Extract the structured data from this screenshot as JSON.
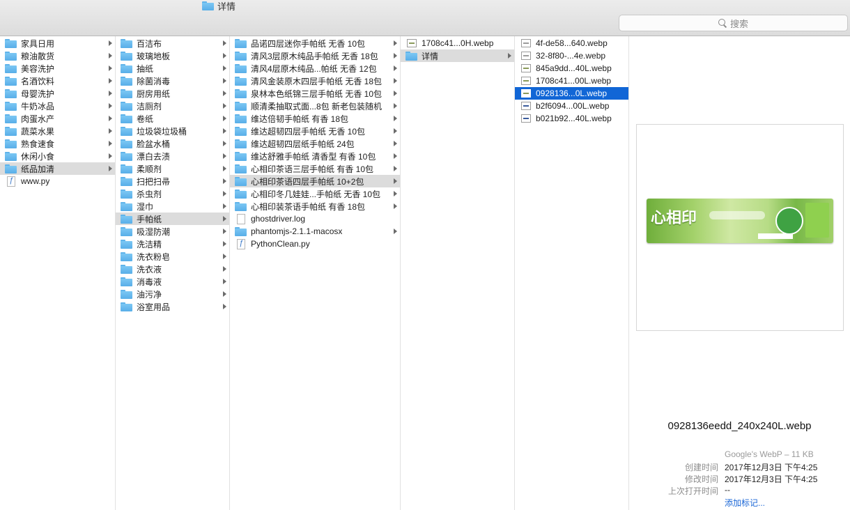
{
  "window": {
    "title": "详情"
  },
  "search": {
    "placeholder": "搜索"
  },
  "columns": {
    "c1": [
      {
        "label": "家具日用",
        "type": "folder",
        "arrow": true
      },
      {
        "label": "粮油散货",
        "type": "folder",
        "arrow": true
      },
      {
        "label": "美容洗护",
        "type": "folder",
        "arrow": true
      },
      {
        "label": "名酒饮料",
        "type": "folder",
        "arrow": true
      },
      {
        "label": "母婴洗护",
        "type": "folder",
        "arrow": true
      },
      {
        "label": "牛奶冰品",
        "type": "folder",
        "arrow": true
      },
      {
        "label": "肉蛋水产",
        "type": "folder",
        "arrow": true
      },
      {
        "label": "蔬菜水果",
        "type": "folder",
        "arrow": true
      },
      {
        "label": "熟食速食",
        "type": "folder",
        "arrow": true
      },
      {
        "label": "休闲小食",
        "type": "folder",
        "arrow": true
      },
      {
        "label": "纸品加清",
        "type": "folder",
        "arrow": true,
        "sel": "gray"
      },
      {
        "label": "www.py",
        "type": "py",
        "arrow": false
      }
    ],
    "c2": [
      {
        "label": "百洁布",
        "type": "folder",
        "arrow": true
      },
      {
        "label": "玻璃地板",
        "type": "folder",
        "arrow": true
      },
      {
        "label": "抽纸",
        "type": "folder",
        "arrow": true
      },
      {
        "label": "除菌消毒",
        "type": "folder",
        "arrow": true
      },
      {
        "label": "厨房用纸",
        "type": "folder",
        "arrow": true
      },
      {
        "label": "洁厕剂",
        "type": "folder",
        "arrow": true
      },
      {
        "label": "卷纸",
        "type": "folder",
        "arrow": true
      },
      {
        "label": "垃圾袋垃圾桶",
        "type": "folder",
        "arrow": true
      },
      {
        "label": "脸盆水桶",
        "type": "folder",
        "arrow": true
      },
      {
        "label": "漂白去渍",
        "type": "folder",
        "arrow": true
      },
      {
        "label": "柔顺剂",
        "type": "folder",
        "arrow": true
      },
      {
        "label": "扫把扫帚",
        "type": "folder",
        "arrow": true
      },
      {
        "label": "杀虫剂",
        "type": "folder",
        "arrow": true
      },
      {
        "label": "湿巾",
        "type": "folder",
        "arrow": true
      },
      {
        "label": "手帕纸",
        "type": "folder",
        "arrow": true,
        "sel": "gray"
      },
      {
        "label": "吸湿防潮",
        "type": "folder",
        "arrow": true
      },
      {
        "label": "洗洁精",
        "type": "folder",
        "arrow": true
      },
      {
        "label": "洗衣粉皂",
        "type": "folder",
        "arrow": true
      },
      {
        "label": "洗衣液",
        "type": "folder",
        "arrow": true
      },
      {
        "label": "消毒液",
        "type": "folder",
        "arrow": true
      },
      {
        "label": "油污净",
        "type": "folder",
        "arrow": true
      },
      {
        "label": "浴室用品",
        "type": "folder",
        "arrow": true
      }
    ],
    "c3": [
      {
        "label": "品诺四层迷你手帕纸 无香 10包",
        "type": "folder",
        "arrow": true
      },
      {
        "label": "清风3层原木纯品手帕纸 无香 18包",
        "type": "folder",
        "arrow": true
      },
      {
        "label": "清风4层原木纯品...帕纸 无香 12包",
        "type": "folder",
        "arrow": true
      },
      {
        "label": "清风金装原木四层手帕纸 无香 18包",
        "type": "folder",
        "arrow": true
      },
      {
        "label": "泉林本色纸锦三层手帕纸 无香 10包",
        "type": "folder",
        "arrow": true
      },
      {
        "label": "顺清柔抽取式面...8包 新老包装随机",
        "type": "folder",
        "arrow": true
      },
      {
        "label": "维达倍韧手帕纸 有香 18包",
        "type": "folder",
        "arrow": true
      },
      {
        "label": "维达超韧四层手帕纸 无香 10包",
        "type": "folder",
        "arrow": true
      },
      {
        "label": "维达超韧四层纸手帕纸 24包",
        "type": "folder",
        "arrow": true
      },
      {
        "label": "维达舒雅手帕纸 清香型 有香 10包",
        "type": "folder",
        "arrow": true
      },
      {
        "label": "心相印茶语三层手帕纸 有香 10包",
        "type": "folder",
        "arrow": true
      },
      {
        "label": "心相印茶语四层手帕纸 10+2包",
        "type": "folder",
        "arrow": true,
        "sel": "gray"
      },
      {
        "label": "心相印冬几娃娃...手帕纸 无香 10包",
        "type": "folder",
        "arrow": true
      },
      {
        "label": "心相印装茶语手帕纸 有香 18包",
        "type": "folder",
        "arrow": true
      },
      {
        "label": "ghostdriver.log",
        "type": "doc",
        "arrow": false
      },
      {
        "label": "phantomjs-2.1.1-macosx",
        "type": "folder",
        "arrow": true
      },
      {
        "label": "PythonClean.py",
        "type": "py",
        "arrow": false
      }
    ],
    "c4": [
      {
        "label": "1708c41...0H.webp",
        "type": "img",
        "arrow": false
      },
      {
        "label": "详情",
        "type": "folder",
        "arrow": true,
        "sel": "gray"
      }
    ],
    "c5": [
      {
        "label": "4f-de58...640.webp",
        "type": "img-gray",
        "arrow": false
      },
      {
        "label": "32-8f80-...4e.webp",
        "type": "img-gray",
        "arrow": false
      },
      {
        "label": "845a9dd...40L.webp",
        "type": "img",
        "arrow": false
      },
      {
        "label": "1708c41...00L.webp",
        "type": "img",
        "arrow": false
      },
      {
        "label": "0928136...0L.webp",
        "type": "img",
        "arrow": false,
        "sel": "blue"
      },
      {
        "label": "b2f6094...00L.webp",
        "type": "img-blue",
        "arrow": false
      },
      {
        "label": "b021b92...40L.webp",
        "type": "img-blue",
        "arrow": false
      }
    ]
  },
  "preview": {
    "brand": "心相印",
    "filename": "0928136eedd_240x240L.webp",
    "kind": "Google's WebP – 11 KB",
    "created_label": "创建时间",
    "created_value": "2017年12月3日 下午4:25",
    "modified_label": "修改时间",
    "modified_value": "2017年12月3日 下午4:25",
    "opened_label": "上次打开时间",
    "opened_value": "--",
    "add_tags": "添加标记..."
  }
}
